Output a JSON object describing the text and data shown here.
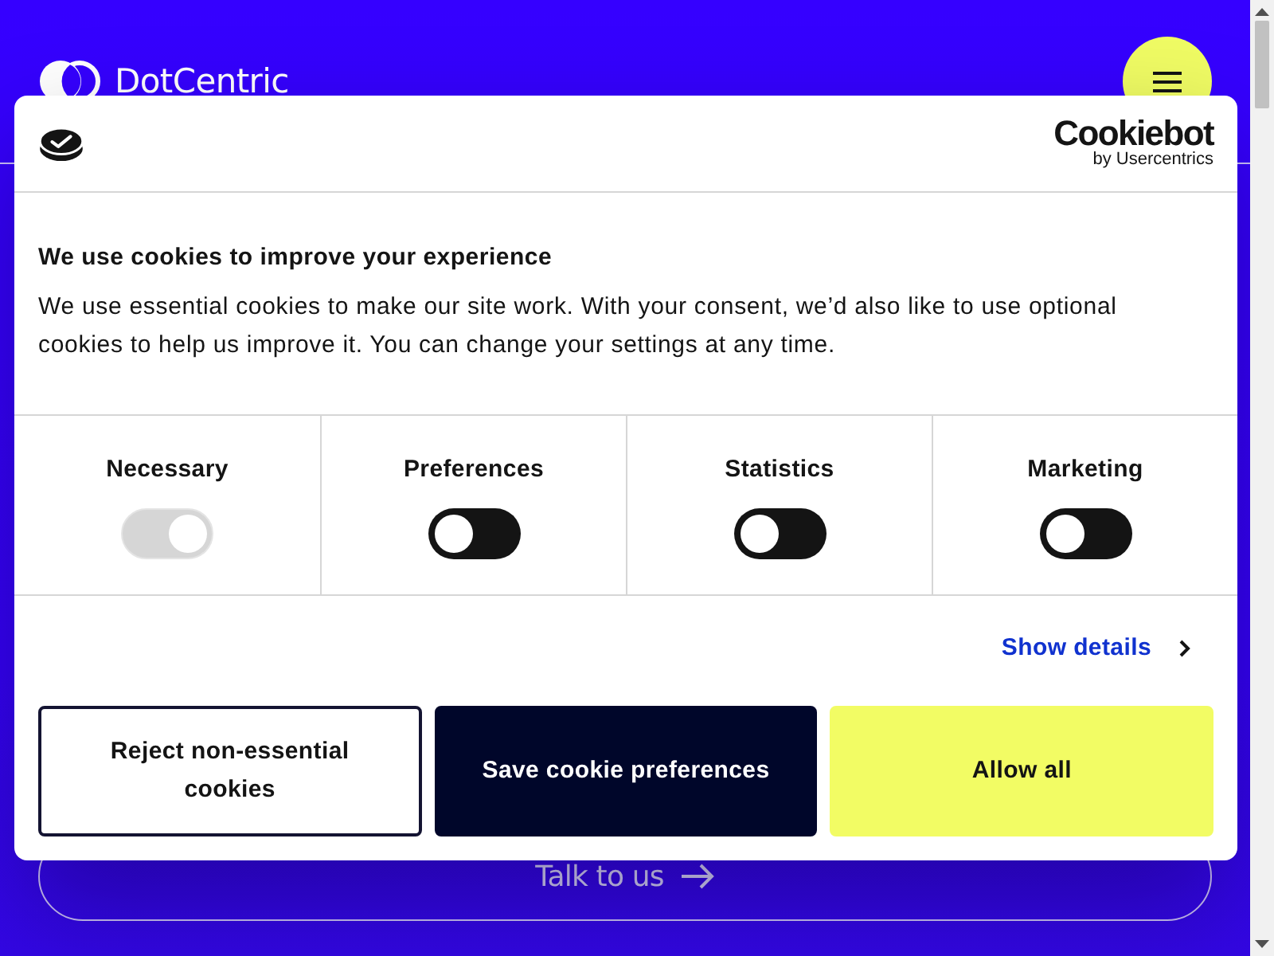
{
  "site": {
    "name": "DotCentric",
    "cta": "Talk to us"
  },
  "cookie_banner": {
    "brand": "Cookiebot",
    "brand_tagline": "by Usercentrics",
    "title": "We use cookies to improve your experience",
    "text": "We use essential cookies to make our site work. With your consent, we’d also like to use optional cookies to help us improve it. You can change your settings at any time.",
    "categories": [
      {
        "label": "Necessary",
        "checked": true,
        "disabled": true
      },
      {
        "label": "Preferences",
        "checked": false,
        "disabled": false
      },
      {
        "label": "Statistics",
        "checked": false,
        "disabled": false
      },
      {
        "label": "Marketing",
        "checked": false,
        "disabled": false
      }
    ],
    "details_link": "Show details",
    "buttons": [
      {
        "label": "Reject non-essential cookies",
        "kind": "outline"
      },
      {
        "label": "Save cookie preferences",
        "kind": "dark"
      },
      {
        "label": "Allow all",
        "kind": "accent"
      }
    ]
  }
}
